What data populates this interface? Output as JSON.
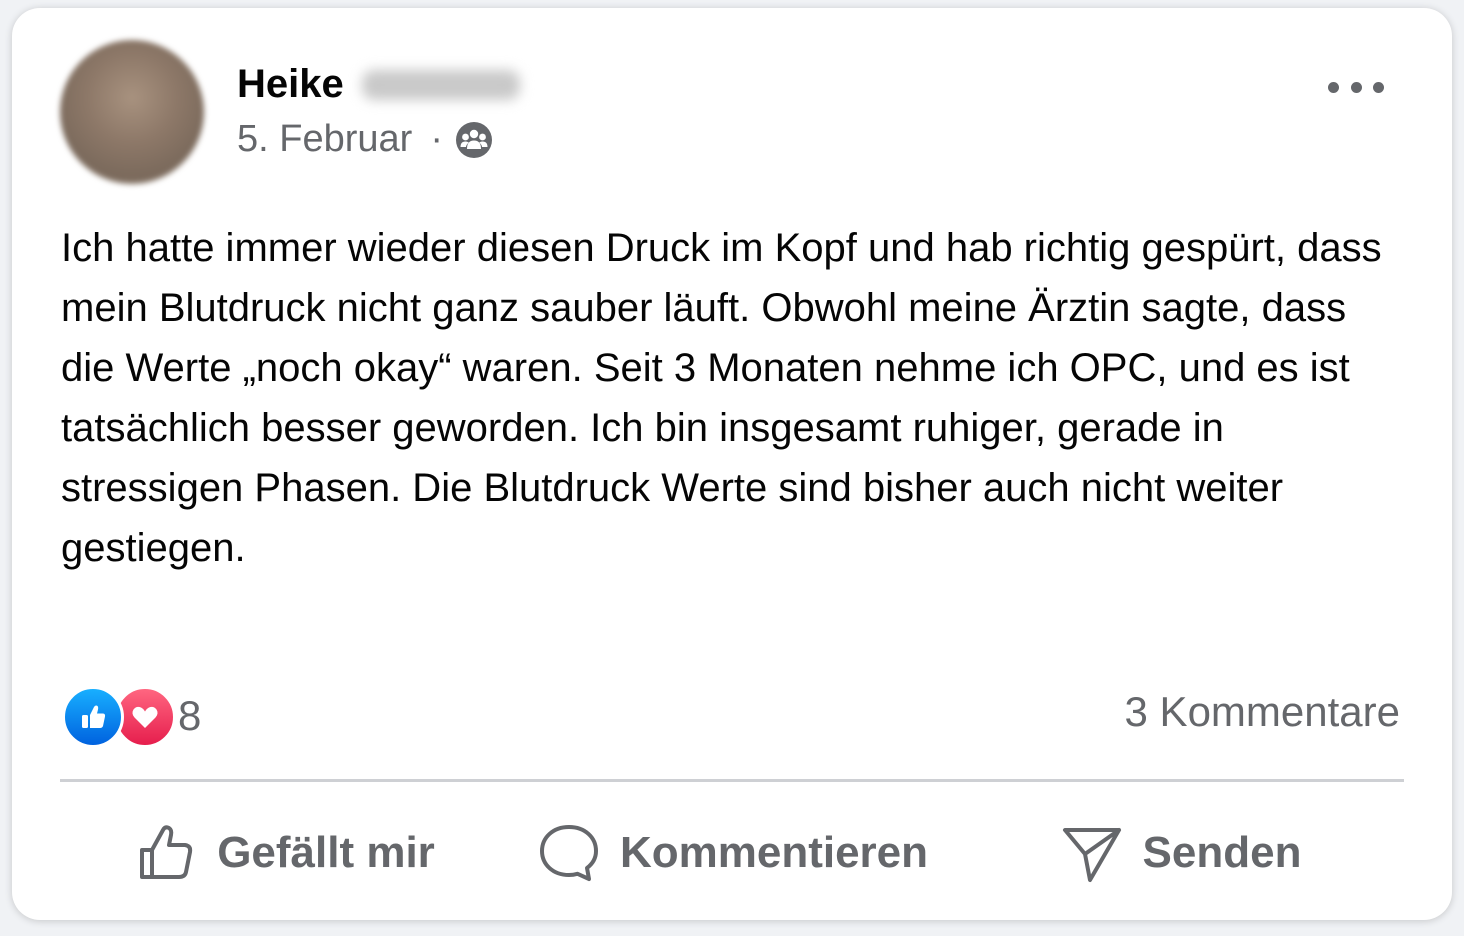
{
  "post": {
    "author_first_name": "Heike",
    "date": "5. Februar",
    "separator": "·",
    "audience_icon": "group-icon",
    "text": "Ich hatte immer wieder diesen Druck im Kopf und hab richtig gespürt, dass mein Blutdruck nicht ganz sauber läuft. Obwohl meine Ärztin sagte, dass die Werte „noch okay“ waren. Seit 3 Monaten nehme ich OPC, und es ist tatsächlich besser geworden. Ich bin insgesamt ruhiger, gerade in stressigen Phasen. Die Blutdruck Werte sind bisher auch nicht weiter gestiegen."
  },
  "reactions": {
    "types": [
      "like",
      "love"
    ],
    "count": "8"
  },
  "comments": {
    "count_label": "3 Kommentare"
  },
  "actions": {
    "like_label": "Gefällt mir",
    "comment_label": "Kommentieren",
    "share_label": "Senden"
  },
  "colors": {
    "text": "#050505",
    "secondary_text": "#65676b",
    "like_blue": "#0866ff",
    "love_red": "#f33e58",
    "divider": "#ced0d4"
  }
}
